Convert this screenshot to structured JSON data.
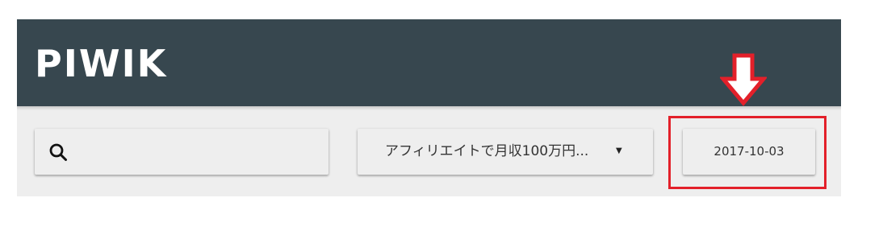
{
  "header": {
    "logo_text": "PIWIK",
    "background_color": "#37474f"
  },
  "search": {
    "icon": "search-icon",
    "value": ""
  },
  "site_selector": {
    "label": "アフィリエイトで月収100万円...",
    "caret": "▼"
  },
  "date_selector": {
    "label": "2017-10-03"
  },
  "annotation": {
    "highlight_color": "#e3202a",
    "arrow_icon": "down-arrow-icon"
  }
}
